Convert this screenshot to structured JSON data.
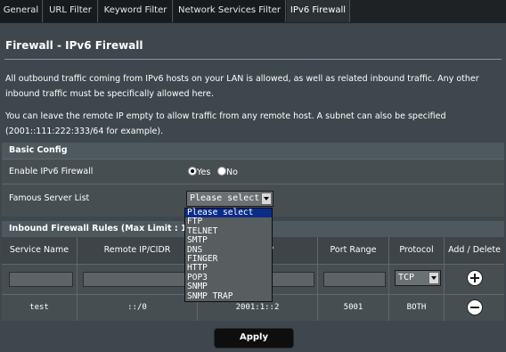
{
  "tabs": [
    "General",
    "URL Filter",
    "Keyword Filter",
    "Network Services Filter",
    "IPv6 Firewall"
  ],
  "active_tab": "IPv6 Firewall",
  "page_title": "Firewall - IPv6 Firewall",
  "description_1": "All outbound traffic coming from IPv6 hosts on your LAN is allowed, as well as related inbound traffic. Any other inbound traffic must be specifically allowed here.",
  "description_2": "You can leave the remote IP empty to allow traffic from any remote host. A subnet can also be specified (2001::111:222:333/64 for example).",
  "basic_config": {
    "header": "Basic Config",
    "enable_label": "Enable IPv6 Firewall",
    "yes_label": "Yes",
    "no_label": "No",
    "enabled": "Yes",
    "server_list_label": "Famous Server List",
    "server_list_value": "Please select"
  },
  "server_list_options": [
    "Please select",
    "FTP",
    "TELNET",
    "SMTP",
    "DNS",
    "FINGER",
    "HTTP",
    "POP3",
    "SNMP",
    "SNMP TRAP"
  ],
  "rules": {
    "header": "Inbound Firewall Rules (Max Limit : 128)",
    "columns": [
      "Service Name",
      "Remote IP/CIDR",
      "Local IP",
      "Port Range",
      "Protocol",
      "Add / Delete"
    ],
    "new_protocol": "TCP",
    "entries": [
      {
        "service": "test",
        "remote": "::/0",
        "local": "2001:1::2",
        "port": "5001",
        "protocol": "BOTH"
      }
    ]
  },
  "apply_label": "Apply",
  "colors": {
    "background": "#3d474d",
    "section_header": "#4d595d",
    "dropdown_highlight": "#0a2b8a"
  },
  "icons": [
    "add-circle-icon",
    "remove-circle-icon",
    "dropdown-arrow-icon",
    "radio-icon"
  ]
}
